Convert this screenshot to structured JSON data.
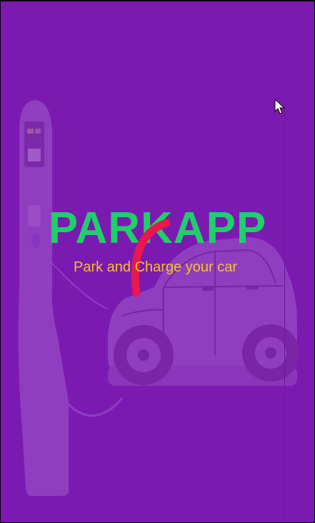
{
  "splash": {
    "app_name": "PARKAPP",
    "tagline": "Park and Charge your car"
  },
  "colors": {
    "background": "#7b1ab1",
    "brand_text": "#1fcf6a",
    "tagline_text": "#f4c12a",
    "spinner": "#e8174f",
    "illustration": "#8f3ec0"
  },
  "icons": {
    "background_art": "ev-charging-car-illustration",
    "loader": "loading-spinner-icon",
    "pointer": "mouse-cursor-icon"
  }
}
